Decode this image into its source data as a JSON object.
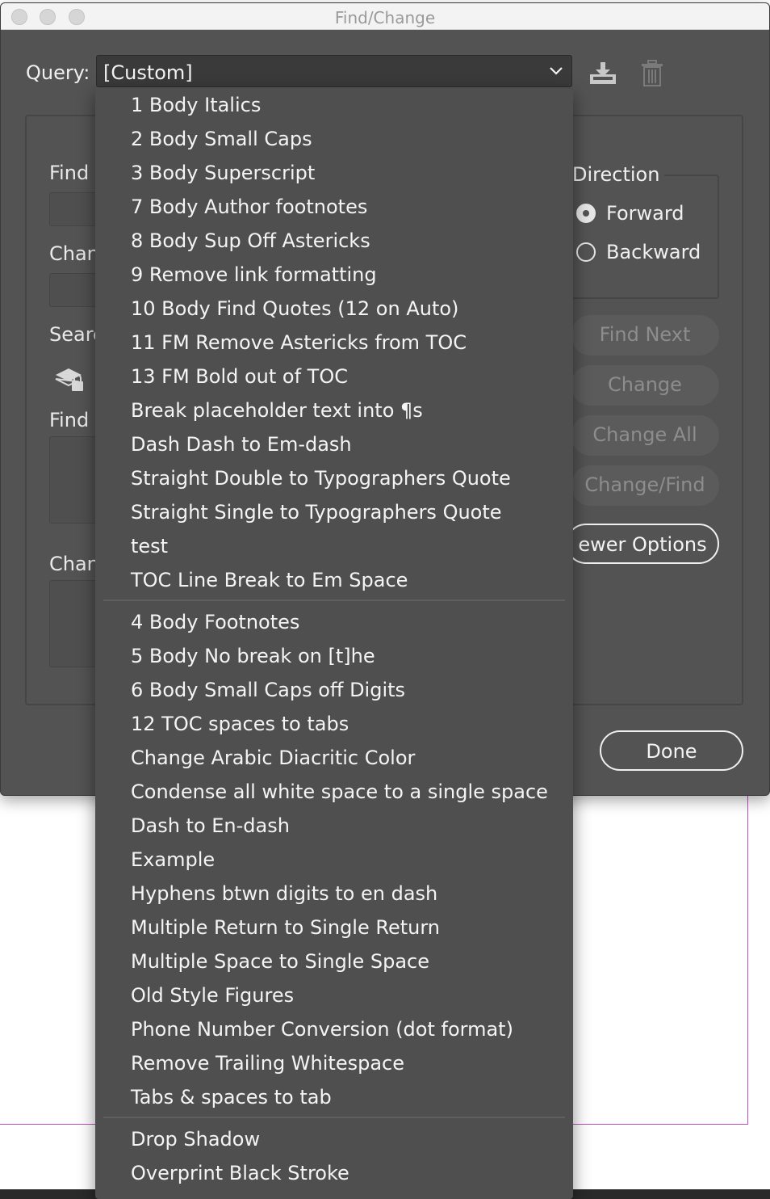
{
  "window": {
    "title": "Find/Change"
  },
  "query": {
    "label": "Query:",
    "value": "[Custom]"
  },
  "icons": {
    "save": "save-query-icon",
    "delete": "delete-query-icon",
    "chevron": "chevron-down-icon",
    "lock": "lock-layers-icon"
  },
  "panel": {
    "find_label": "Find",
    "change_label": "Chan",
    "search_label": "Searc",
    "find_format_label": "Find",
    "change_format_label": "Chan"
  },
  "direction": {
    "label": "Direction",
    "options": [
      {
        "label": "Forward",
        "selected": true
      },
      {
        "label": "Backward",
        "selected": false
      }
    ]
  },
  "buttons": {
    "find_next": "Find Next",
    "change": "Change",
    "change_all": "Change All",
    "change_find": "Change/Find",
    "fewer_options": "ewer Options",
    "done": "Done"
  },
  "menu": {
    "group1": [
      "1 Body Italics",
      "2 Body Small Caps",
      "3 Body Superscript",
      "7 Body Author footnotes",
      "8 Body Sup Off Astericks",
      "9 Remove link formatting",
      "10 Body Find Quotes (12 on Auto)",
      "11 FM Remove Astericks from TOC",
      "13 FM Bold out of TOC",
      "Break placeholder text into ¶s",
      "Dash Dash to Em-dash",
      "Straight Double to Typographers Quote",
      "Straight Single to Typographers Quote",
      "test",
      "TOC Line Break to Em Space"
    ],
    "group2": [
      "4 Body Footnotes",
      "5 Body No break on [t]he",
      "6 Body Small Caps off Digits",
      "12 TOC spaces to tabs",
      "Change Arabic Diacritic Color",
      "Condense all white space to a single space",
      "Dash to En-dash",
      "Example",
      "Hyphens btwn digits to en dash",
      "Multiple Return to Single Return",
      "Multiple Space to Single Space",
      "Old Style Figures",
      "Phone Number Conversion (dot format)",
      "Remove Trailing Whitespace",
      "Tabs & spaces to tab"
    ],
    "group3": [
      "Drop Shadow",
      "Overprint Black Stroke"
    ]
  }
}
